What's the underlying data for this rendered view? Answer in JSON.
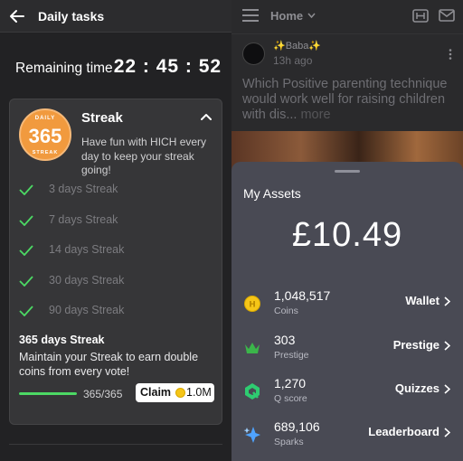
{
  "left": {
    "header": {
      "title": "Daily tasks",
      "back_icon": "back-arrow-icon"
    },
    "timer": {
      "label": "Remaining time",
      "value": "22 : 45 : 52"
    },
    "streak_card": {
      "badge": {
        "top": "DAILY",
        "number": "365",
        "bottom": "STREAK",
        "color": "#f19a3e"
      },
      "title": "Streak",
      "description": "Have fun with HICH every day to keep your streak going!",
      "items": [
        {
          "label": "3 days Streak"
        },
        {
          "label": "7 days Streak"
        },
        {
          "label": "14 days Streak"
        },
        {
          "label": "30 days Streak"
        },
        {
          "label": "90 days Streak"
        }
      ],
      "current": {
        "title": "365 days Streak",
        "description": "Maintain your Streak to earn double coins from every vote!",
        "progress_text": "365/365",
        "progress_fraction": 1.0,
        "claim_label": "Claim",
        "claim_amount": "1.0M"
      }
    }
  },
  "right": {
    "header": {
      "title": "Home"
    },
    "post": {
      "user": "✨Baba✨",
      "time": "13h ago",
      "question": "Which Positive parenting technique would work well for raising children with dis...",
      "more": "more"
    },
    "assets": {
      "title": "My Assets",
      "total": "£10.49",
      "rows": [
        {
          "value": "1,048,517",
          "sub": "Coins",
          "link": "Wallet",
          "icon": "coin-icon"
        },
        {
          "value": "303",
          "sub": "Prestige",
          "link": "Prestige",
          "icon": "crown-icon"
        },
        {
          "value": "1,270",
          "sub": "Q score",
          "link": "Quizzes",
          "icon": "q-score-icon"
        },
        {
          "value": "689,106",
          "sub": "Sparks",
          "link": "Leaderboard",
          "icon": "sparks-icon"
        }
      ]
    }
  },
  "colors": {
    "accent_green": "#4cd964",
    "badge_orange": "#f19a3e",
    "sheet_bg": "#494a54",
    "crown_green": "#3bb54a",
    "q_green": "#2ecc71",
    "spark_blue": "#4fa3ff",
    "coin_yellow": "#f5c518"
  }
}
